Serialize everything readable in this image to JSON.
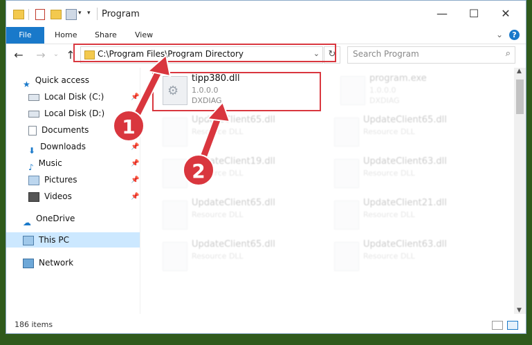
{
  "window": {
    "title": "Program"
  },
  "title_buttons": {
    "minimize": "—",
    "maximize": "☐",
    "close": "✕"
  },
  "ribbon": {
    "tabs": [
      {
        "label": "File"
      },
      {
        "label": "Home"
      },
      {
        "label": "Share"
      },
      {
        "label": "View"
      }
    ],
    "expand": "⌄",
    "help": "?"
  },
  "address_bar": {
    "path": "C:\\Program Files\\Program Directory",
    "search_placeholder": "Search Program"
  },
  "sidebar": {
    "items": [
      {
        "label": "Quick access",
        "icon": "star-icon",
        "pinned": false
      },
      {
        "label": "Local Disk (C:)",
        "icon": "drive-icon",
        "pinned": true
      },
      {
        "label": "Local Disk (D:)",
        "icon": "drive-icon",
        "pinned": false
      },
      {
        "label": "Documents",
        "icon": "documents-icon",
        "pinned": true
      },
      {
        "label": "Downloads",
        "icon": "downloads-icon",
        "pinned": true
      },
      {
        "label": "Music",
        "icon": "music-icon",
        "pinned": true
      },
      {
        "label": "Pictures",
        "icon": "pictures-icon",
        "pinned": true
      },
      {
        "label": "Videos",
        "icon": "videos-icon",
        "pinned": true
      },
      {
        "label": "OneDrive",
        "icon": "cloud-icon",
        "pinned": false
      },
      {
        "label": "This PC",
        "icon": "computer-icon",
        "pinned": false,
        "selected": true
      },
      {
        "label": "Network",
        "icon": "network-icon",
        "pinned": false
      }
    ]
  },
  "files": {
    "highlighted": {
      "name": "tipp380.dll",
      "version": "1.0.0.0",
      "description": "DXDIAG"
    },
    "others": [
      {
        "name": "program.exe",
        "line2": "1.0.0.0",
        "line3": "DXDIAG"
      },
      {
        "name": "UpdateClient65.dll",
        "line2": "Resource DLL"
      },
      {
        "name": "UpdateClient65.dll",
        "line2": "Resource DLL"
      },
      {
        "name": "UpdateClient19.dll",
        "line2": "Resource DLL"
      },
      {
        "name": "UpdateClient63.dll",
        "line2": "Resource DLL"
      },
      {
        "name": "UpdateClient65.dll",
        "line2": "Resource DLL"
      },
      {
        "name": "UpdateClient21.dll",
        "line2": "Resource DLL"
      },
      {
        "name": "UpdateClient65.dll",
        "line2": "Resource DLL"
      },
      {
        "name": "UpdateClient63.dll",
        "line2": "Resource DLL"
      }
    ]
  },
  "status": {
    "item_count": "186 items"
  },
  "annotations": {
    "step1": "1",
    "step2": "2"
  },
  "colors": {
    "accent": "#1979ca",
    "annotation_red": "#d9363e",
    "selected_bg": "#cce8ff"
  }
}
